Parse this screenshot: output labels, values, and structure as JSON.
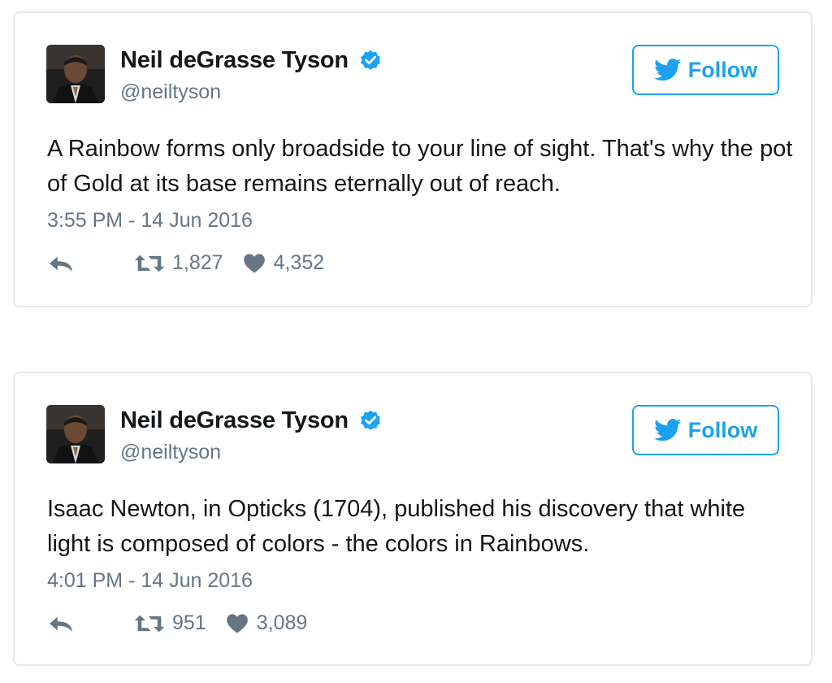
{
  "tweets": [
    {
      "display_name": "Neil deGrasse Tyson",
      "handle": "@neiltyson",
      "follow_label": "Follow",
      "text": "A Rainbow forms only broadside to your line of sight. That's why the pot of Gold at its base remains eternally out of reach.",
      "timestamp": "3:55 PM - 14 Jun 2016",
      "retweets": "1,827",
      "likes": "4,352"
    },
    {
      "display_name": "Neil deGrasse Tyson",
      "handle": "@neiltyson",
      "follow_label": "Follow",
      "text": "Isaac Newton, in Opticks (1704), published his discovery that white light is composed of colors - the colors in Rainbows.",
      "timestamp": "4:01 PM - 14 Jun 2016",
      "retweets": "951",
      "likes": "3,089"
    }
  ],
  "icons": {
    "verified": "verified-badge-icon",
    "bird": "twitter-bird-icon",
    "reply": "reply-icon",
    "retweet": "retweet-icon",
    "like": "heart-icon"
  },
  "colors": {
    "accent": "#1da1f2",
    "verified": "#1da1f2",
    "muted": "#657786",
    "border": "#e1e8ed",
    "text": "#14171a"
  }
}
